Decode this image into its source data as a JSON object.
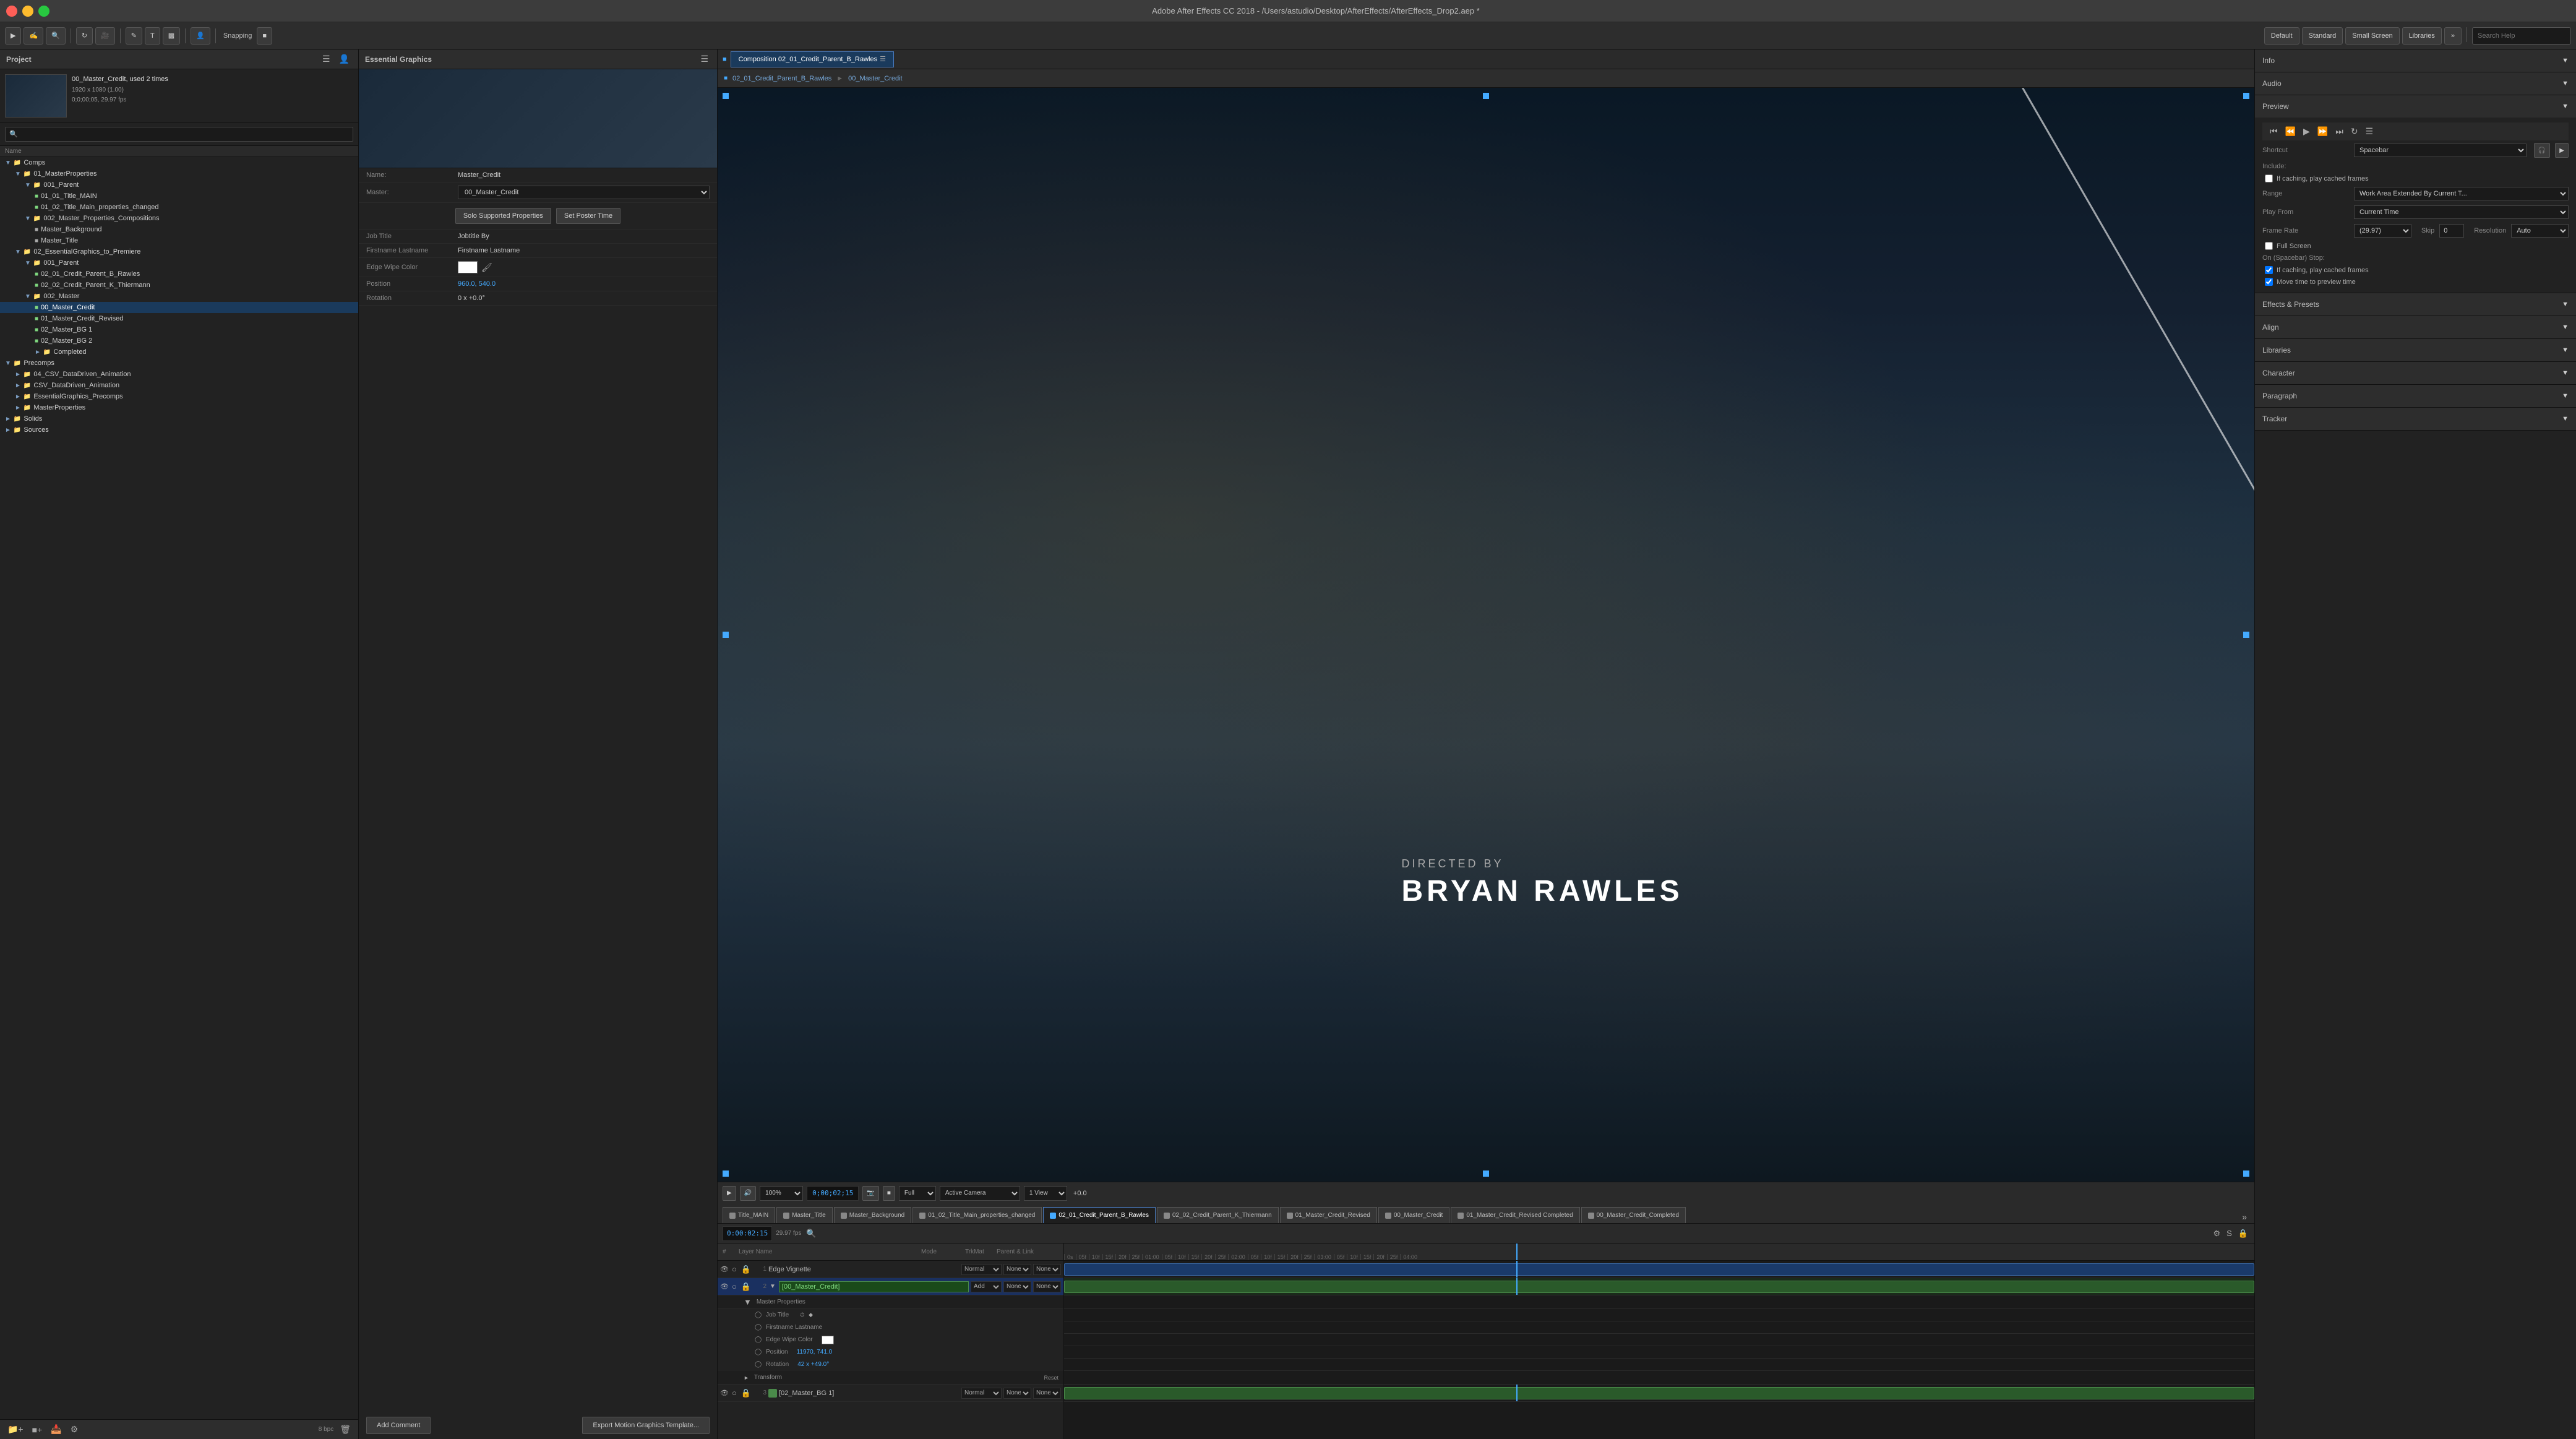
{
  "app": {
    "title": "Adobe After Effects CC 2018 - /Users/astudio/Desktop/AfterEffects/AfterEffects_Drop2.aep *",
    "traffic_lights": [
      "close",
      "minimize",
      "maximize"
    ]
  },
  "toolbar": {
    "snapping_label": "Snapping",
    "workspace_buttons": [
      "Default",
      "Standard",
      "Small Screen",
      "Libraries"
    ],
    "search_placeholder": "Search Help"
  },
  "project_panel": {
    "title": "Project",
    "filename": "00_Master_Credit",
    "used_times": "used 2 times",
    "resolution": "1920 x 1080 (1.00)",
    "framerate": "0;0;00;05, 29.97 fps",
    "name_col": "Name",
    "bottom_info": "8 bpc",
    "tree": [
      {
        "id": "comps",
        "label": "Comps",
        "type": "folder",
        "indent": 0,
        "expanded": true
      },
      {
        "id": "01_masterprops",
        "label": "01_MasterProperties",
        "type": "folder",
        "indent": 1,
        "expanded": true
      },
      {
        "id": "001_parent",
        "label": "001_Parent",
        "type": "folder",
        "indent": 2,
        "expanded": true
      },
      {
        "id": "01_01_title_main",
        "label": "01_01_Title_MAIN",
        "type": "comp",
        "indent": 3
      },
      {
        "id": "01_02_title_main_changed",
        "label": "01_02_Title_Main_properties_changed",
        "type": "comp",
        "indent": 3
      },
      {
        "id": "002_masterprops_comps",
        "label": "002_Master_Properties_Compositions",
        "type": "folder",
        "indent": 2,
        "expanded": true
      },
      {
        "id": "master_background",
        "label": "Master_Background",
        "type": "item",
        "indent": 3
      },
      {
        "id": "master_title",
        "label": "Master_Title",
        "type": "item",
        "indent": 3
      },
      {
        "id": "02_essentialgraphics",
        "label": "02_EssentialGraphics_to_Premiere",
        "type": "folder",
        "indent": 1,
        "expanded": true
      },
      {
        "id": "001_parent2",
        "label": "001_Parent",
        "type": "folder",
        "indent": 2,
        "expanded": true
      },
      {
        "id": "02_01_credit_parent_b_rawles",
        "label": "02_01_Credit_Parent_B_Rawles",
        "type": "comp",
        "indent": 3
      },
      {
        "id": "02_02_credit_parent_k_thiermann",
        "label": "02_02_Credit_Parent_K_Thiermann",
        "type": "comp",
        "indent": 3
      },
      {
        "id": "002_master",
        "label": "002_Master",
        "type": "folder",
        "indent": 2,
        "expanded": true
      },
      {
        "id": "00_master_credit",
        "label": "00_Master_Credit",
        "type": "comp",
        "indent": 3,
        "selected": true
      },
      {
        "id": "01_master_credit_revised",
        "label": "01_Master_Credit_Revised",
        "type": "comp",
        "indent": 3
      },
      {
        "id": "02_master_bg1",
        "label": "02_Master_BG 1",
        "type": "comp",
        "indent": 3
      },
      {
        "id": "02_master_bg2",
        "label": "02_Master_BG 2",
        "type": "comp",
        "indent": 3
      },
      {
        "id": "completed",
        "label": "Completed",
        "type": "folder",
        "indent": 3
      },
      {
        "id": "precomps",
        "label": "Precomps",
        "type": "folder",
        "indent": 0,
        "expanded": true
      },
      {
        "id": "04_csv_datadriven_animation",
        "label": "04_CSV_DataDriven_Animation",
        "type": "folder",
        "indent": 1
      },
      {
        "id": "csv_datadriven_animation",
        "label": "CSV_DataDriven_Animation",
        "type": "folder",
        "indent": 1
      },
      {
        "id": "essentialgraphics_precomps",
        "label": "EssentialGraphics_Precomps",
        "type": "folder",
        "indent": 1
      },
      {
        "id": "masterproperties",
        "label": "MasterProperties",
        "type": "folder",
        "indent": 1
      },
      {
        "id": "solids",
        "label": "Solids",
        "type": "folder",
        "indent": 0
      },
      {
        "id": "sources",
        "label": "Sources",
        "type": "folder",
        "indent": 0
      }
    ]
  },
  "essential_graphics": {
    "title": "Essential Graphics",
    "name_label": "Name:",
    "name_value": "Master_Credit",
    "master_label": "Master:",
    "master_value": "00_Master_Credit",
    "solo_btn": "Solo Supported Properties",
    "poster_btn": "Set Poster Time",
    "job_title_label": "Job Title",
    "job_title_value": "Jobtitle By",
    "firstname_label": "Firstname Lastname",
    "firstname_value": "Firstname Lastname",
    "edge_wipe_label": "Edge Wipe Color",
    "position_label": "Position",
    "position_value": "960.0, 540.0",
    "rotation_label": "Rotation",
    "rotation_value": "0 x +0.0°",
    "add_comment_btn": "Add Comment",
    "export_btn": "Export Motion Graphics Template..."
  },
  "composition": {
    "tab_label": "Composition 02_01_Credit_Parent_B_Rawles",
    "breadcrumb_root": "02_01_Credit_Parent_B_Rawles",
    "breadcrumb_child": "00_Master_Credit",
    "directed_by": "DIRECTED BY",
    "name": "BRYAN RAWLES",
    "timecode": "0;00;02;15",
    "zoom": "100%",
    "quality": "Full",
    "camera": "Active Camera",
    "view": "1 View",
    "color_offset": "+0.0"
  },
  "right_panel": {
    "info_title": "Info",
    "audio_title": "Audio",
    "preview_title": "Preview",
    "current_time_label": "Current Time",
    "frame_rate_label": "Frame Rate",
    "skip_label": "Skip",
    "resolution_label": "Resolution",
    "play_from_label": "Play From",
    "play_from_value": "Current Time",
    "frame_rate_value": "(29.97)",
    "skip_value": "0",
    "resolution_value": "Auto",
    "full_screen_label": "Full Screen",
    "on_spacebar_label": "On (Spacebar) Stop:",
    "cache_label": "If caching, play cached frames",
    "move_time_label": "Move time to preview time",
    "range_label": "Range",
    "range_value": "Work Area Extended By Current T...",
    "effects_presets_title": "Effects & Presets",
    "align_title": "Align",
    "libraries_title": "Libraries",
    "character_title": "Character",
    "paragraph_title": "Paragraph",
    "tracker_title": "Tracker"
  },
  "timeline": {
    "timecode": "0:00:02:15",
    "fps": "29.97 fps",
    "tabs": [
      {
        "label": "Title_MAIN",
        "color": "#888"
      },
      {
        "label": "Master_Title",
        "color": "#888"
      },
      {
        "label": "Master_Background",
        "color": "#888"
      },
      {
        "label": "01_02_Title_Main_properties_changed",
        "color": "#888"
      },
      {
        "label": "02_01_Credit_Parent_B_Rawles",
        "color": "#4af",
        "active": true
      },
      {
        "label": "02_02_Credit_Parent_K_Thiermann",
        "color": "#888"
      },
      {
        "label": "01_Master_Credit_Revised",
        "color": "#888"
      },
      {
        "label": "00_Master_Credit",
        "color": "#888"
      },
      {
        "label": "01_Master_Credit_Revised Completed",
        "color": "#888"
      },
      {
        "label": "00_Master_Credit_Completed",
        "color": "#888"
      }
    ],
    "layers": [
      {
        "num": 1,
        "name": "Edge Vignette",
        "mode": "Normal",
        "add": "None",
        "selected": false,
        "color": "#888"
      },
      {
        "num": 2,
        "name": "[00_Master_Credit]",
        "mode": "Add",
        "add": "None",
        "selected": true,
        "color": "#4a8a4a",
        "expanded": true,
        "props": {
          "master_properties": "Master Properties",
          "job_title": "Job Title",
          "firstname": "Firstname Lastname",
          "edge_wipe_color": "Edge Wipe Color",
          "position": "Position",
          "position_value": "11970, 741.0",
          "rotation": "Rotation",
          "rotation_value": "42 x +49.0°",
          "transform": "Transform"
        }
      },
      {
        "num": 3,
        "name": "[02_Master_BG 1]",
        "mode": "Normal",
        "add": "None",
        "selected": false,
        "color": "#888"
      }
    ]
  }
}
